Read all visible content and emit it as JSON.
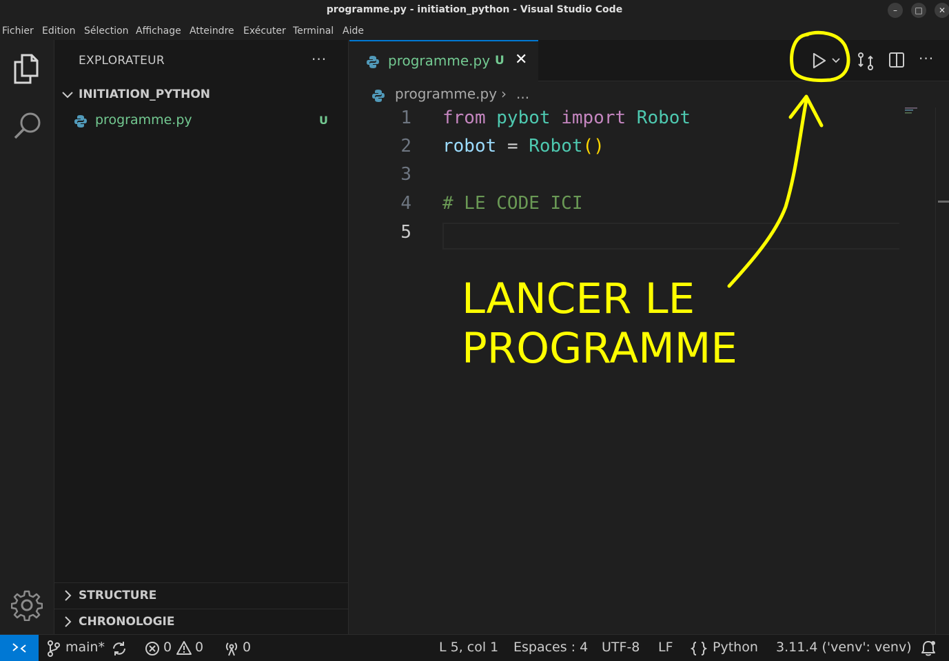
{
  "window": {
    "title": "programme.py - initiation_python - Visual Studio Code",
    "minimize": "–",
    "maximize": "□",
    "close": "✕"
  },
  "menu": [
    "Fichier",
    "Edition",
    "Sélection",
    "Affichage",
    "Atteindre",
    "Exécuter",
    "Terminal",
    "Aide"
  ],
  "sidebar": {
    "title": "EXPLORATEUR",
    "more": "···",
    "folder": "INITIATION_PYTHON",
    "file": {
      "name": "programme.py",
      "status": "U"
    },
    "sections": [
      "STRUCTURE",
      "CHRONOLOGIE"
    ]
  },
  "editor": {
    "tab": {
      "label": "programme.py",
      "status": "U",
      "close": "✕"
    },
    "breadcrumb": {
      "file": "programme.py",
      "separator": "›",
      "more": "..."
    },
    "line_numbers": [
      "1",
      "2",
      "3",
      "4",
      "5"
    ],
    "code": {
      "l1_from": "from",
      "l1_module": "pybot",
      "l1_import": "import",
      "l1_class": "Robot",
      "l2_var": "robot",
      "l2_eq": "=",
      "l2_class": "Robot",
      "l2_parens": "()",
      "l4_comment": "# LE CODE ICI"
    },
    "more_actions": "···"
  },
  "annotation": {
    "line1": "LANCER LE",
    "line2": "PROGRAMME",
    "color": "#ffff00"
  },
  "statusbar": {
    "branch": "main*",
    "errors": "0",
    "warnings": "0",
    "ports": "0",
    "cursor": "L 5, col 1",
    "spaces": "Espaces : 4",
    "encoding": "UTF-8",
    "eol": "LF",
    "language": "Python",
    "interpreter": "3.11.4 ('venv': venv)"
  },
  "colors": {
    "accent": "#0078d4",
    "untracked": "#73c991"
  }
}
